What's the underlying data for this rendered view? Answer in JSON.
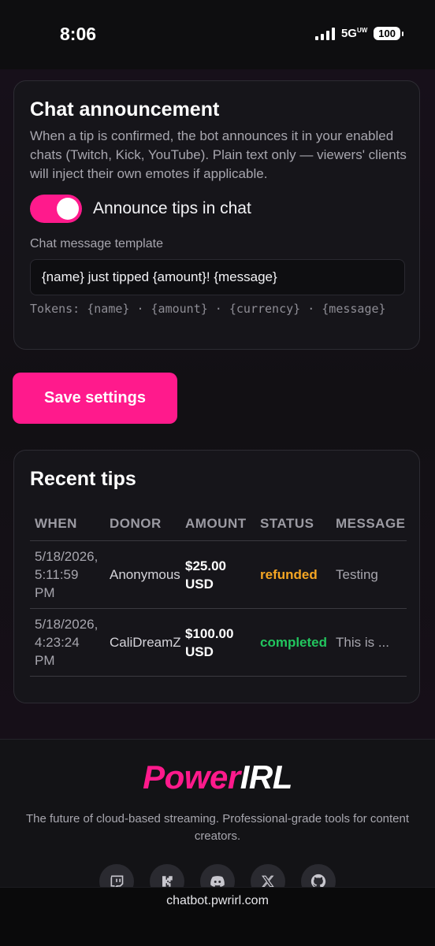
{
  "status_bar": {
    "time": "8:06",
    "network": "5G",
    "network_sup": "UW",
    "battery": "100"
  },
  "announcement": {
    "title": "Chat announcement",
    "description": "When a tip is confirmed, the bot announces it in your enabled chats (Twitch, Kick, YouTube). Plain text only — viewers' clients will inject their own emotes if applicable.",
    "toggle_label": "Announce tips in chat",
    "toggle_on": true,
    "template_label": "Chat message template",
    "template_value": "{name} just tipped {amount}! {message}",
    "tokens": "Tokens: {name} · {amount} · {currency} · {message}"
  },
  "save_label": "Save settings",
  "recent_tips": {
    "title": "Recent tips",
    "headers": [
      "WHEN",
      "DONOR",
      "AMOUNT",
      "STATUS",
      "MESSAGE"
    ],
    "rows": [
      {
        "when": "5/18/2026, 5:11:59 PM",
        "donor": "Anonymous",
        "amount": "$25.00 USD",
        "status": "refunded",
        "message": "Testing"
      },
      {
        "when": "5/18/2026, 4:23:24 PM",
        "donor": "CaliDreamZ",
        "amount": "$100.00 USD",
        "status": "completed",
        "message": "This is ..."
      }
    ]
  },
  "footer": {
    "logo_part1": "Power",
    "logo_part2": "IRL",
    "tagline": "The future of cloud-based streaming. Professional-grade tools for content creators.",
    "socials": [
      "twitch-icon",
      "kick-icon",
      "discord-icon",
      "x-icon",
      "github-icon"
    ]
  },
  "url": "chatbot.pwrirl.com",
  "colors": {
    "accent": "#ff1a8c",
    "refunded": "#f5a623",
    "completed": "#22c55e"
  }
}
